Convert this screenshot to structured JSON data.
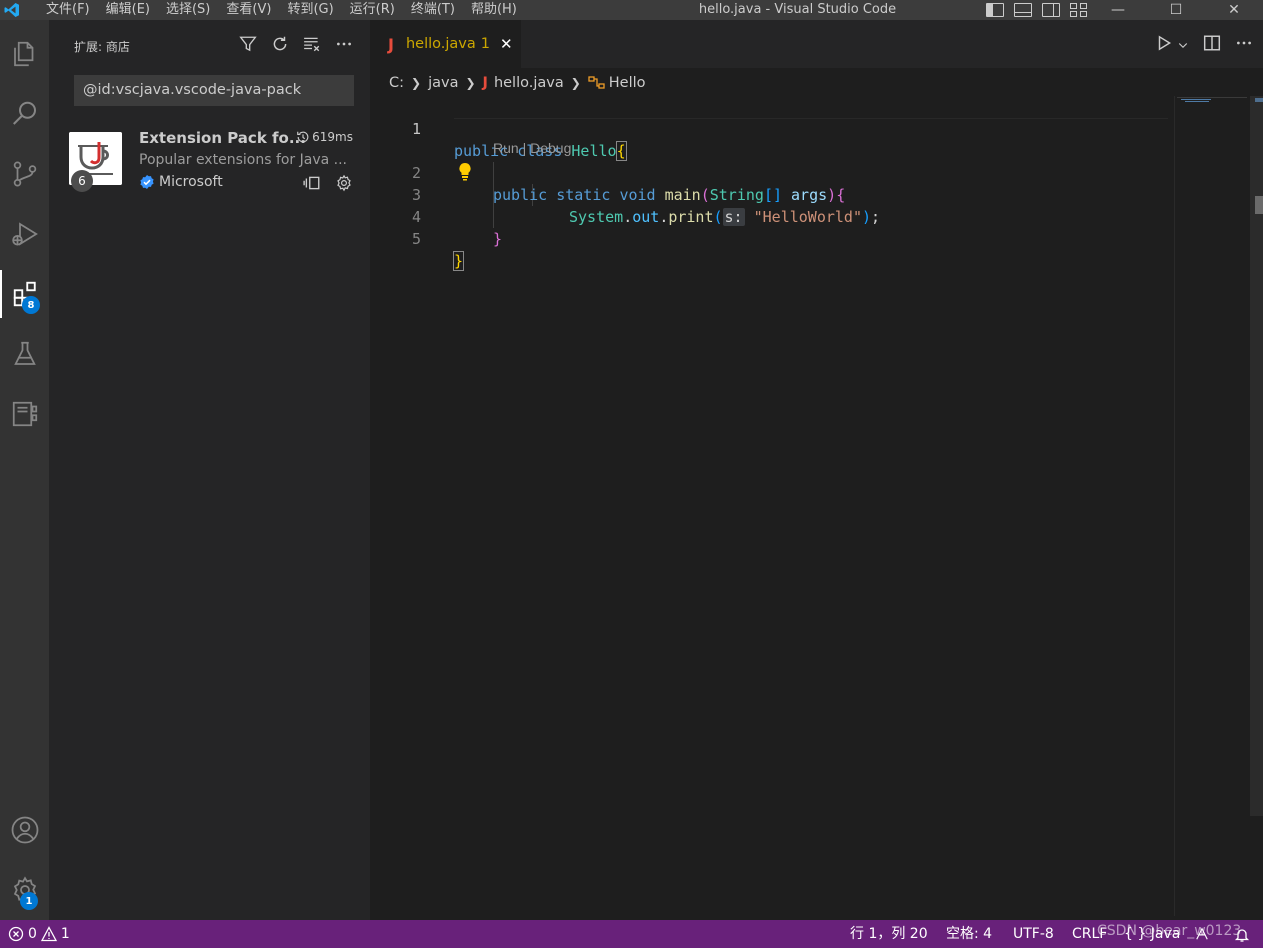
{
  "titlebar": {
    "menu": [
      "文件(F)",
      "编辑(E)",
      "选择(S)",
      "查看(V)",
      "转到(G)",
      "运行(R)",
      "终端(T)",
      "帮助(H)"
    ],
    "window_title": "hello.java - Visual Studio Code",
    "controls": [
      "—",
      "☐",
      "✕"
    ]
  },
  "activitybar": {
    "items": [
      "explorer-icon",
      "search-icon",
      "source-control-icon",
      "run-debug-icon",
      "extensions-icon",
      "testing-icon",
      "remote-explorer-icon"
    ],
    "extensions_badge": "8",
    "settings_badge": "1"
  },
  "sidebar": {
    "title": "扩展: 商店",
    "search_value": "@id:vscjava.vscode-java-pack",
    "extension": {
      "name": "Extension Pack fo...",
      "time": "619ms",
      "description": "Popular extensions for Java ...",
      "publisher": "Microsoft",
      "count": "6"
    }
  },
  "editor": {
    "tab": {
      "name": "hello.java",
      "problems": "1",
      "close": "✕"
    },
    "breadcrumb": [
      "C:",
      "java",
      "hello.java",
      "Hello"
    ],
    "codelens": "Run | Debug",
    "line_numbers": [
      "1",
      "2",
      "3",
      "4",
      "5"
    ],
    "code": {
      "l1_kw1": "public",
      "l1_kw2": "class",
      "l1_cls": "Hello",
      "l1_br": "{",
      "l2_kw1": "public",
      "l2_kw2": "static",
      "l2_kw3": "void",
      "l2_fn": "main",
      "l2_p1": "(",
      "l2_ty": "String",
      "l2_arr": "[]",
      "l2_var": "args",
      "l2_p2": ")",
      "l2_br": "{",
      "l3_cls": "System",
      "l3_dot1": ".",
      "l3_field": "out",
      "l3_dot2": ".",
      "l3_fn": "print",
      "l3_p1": "(",
      "l3_hint": "s:",
      "l3_str": "\"HelloWorld\"",
      "l3_p2": ")",
      "l3_semi": ";",
      "l4_br": "}",
      "l5_br": "}"
    }
  },
  "statusbar": {
    "errors": "0",
    "warnings": "1",
    "position": "行 1，列 20",
    "spaces": "空格: 4",
    "encoding": "UTF-8",
    "eol": "CRLF",
    "language": "{ } Java"
  },
  "watermark": "CSDN @bear_w0123"
}
